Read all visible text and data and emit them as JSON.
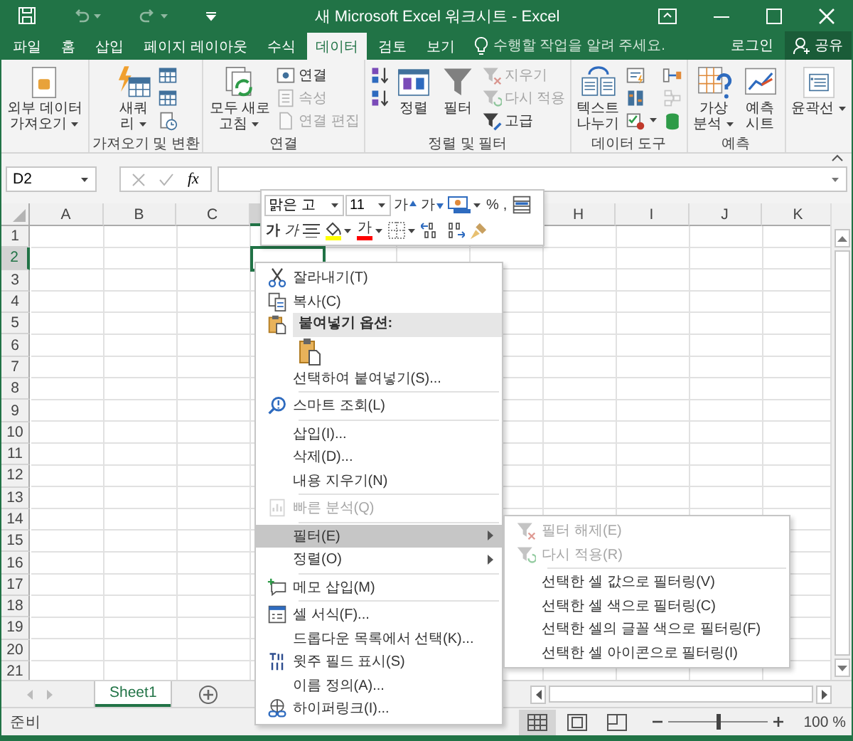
{
  "window": {
    "title": "새 Microsoft Excel 워크시트 - Excel"
  },
  "tabs": [
    {
      "label": "파일",
      "selected": false
    },
    {
      "label": "홈",
      "selected": false
    },
    {
      "label": "삽입",
      "selected": false
    },
    {
      "label": "페이지 레이아웃",
      "selected": false
    },
    {
      "label": "수식",
      "selected": false
    },
    {
      "label": "데이터",
      "selected": true
    },
    {
      "label": "검토",
      "selected": false
    },
    {
      "label": "보기",
      "selected": false
    }
  ],
  "tell_me": {
    "placeholder": "수행할 작업을 알려 주세요."
  },
  "account": {
    "login": "로그인",
    "share": "공유"
  },
  "ribbon": {
    "groups": [
      {
        "buttons": [
          {
            "kind": "large",
            "lines": [
              "외부 데이터",
              "가져오기"
            ],
            "dropdown": true
          }
        ]
      },
      {
        "label": "가져오기 및 변환",
        "buttons": [
          {
            "kind": "large",
            "lines": [
              "새쿼",
              "리"
            ],
            "dropdown": true
          },
          {
            "kind": "icon"
          },
          {
            "kind": "icon"
          },
          {
            "kind": "icon"
          }
        ]
      },
      {
        "label": "연결",
        "buttons": [
          {
            "kind": "large",
            "lines": [
              "모두 새로",
              "고침"
            ],
            "dropdown": true
          },
          {
            "kind": "small",
            "label": "연결",
            "disabled": false
          },
          {
            "kind": "small",
            "label": "속성",
            "disabled": true
          },
          {
            "kind": "small",
            "label": "연결 편집",
            "disabled": true
          }
        ]
      },
      {
        "label": "정렬 및 필터",
        "buttons": [
          {
            "kind": "icon"
          },
          {
            "kind": "icon"
          },
          {
            "kind": "large",
            "lines": [
              "정렬"
            ]
          },
          {
            "kind": "large",
            "lines": [
              "필터"
            ]
          },
          {
            "kind": "small",
            "label": "지우기",
            "disabled": true
          },
          {
            "kind": "small",
            "label": "다시 적용",
            "disabled": true
          },
          {
            "kind": "small",
            "label": "고급",
            "disabled": false
          }
        ]
      },
      {
        "label": "데이터 도구",
        "buttons": [
          {
            "kind": "large",
            "lines": [
              "텍스트",
              "나누기"
            ]
          },
          {
            "kind": "icon"
          },
          {
            "kind": "icon"
          },
          {
            "kind": "icon",
            "dropdown": true
          },
          {
            "kind": "icon"
          },
          {
            "kind": "icon",
            "disabled": true
          },
          {
            "kind": "icon"
          }
        ]
      },
      {
        "label": "예측",
        "buttons": [
          {
            "kind": "large",
            "lines": [
              "가상",
              "분석"
            ],
            "dropdown": true
          },
          {
            "kind": "large",
            "lines": [
              "예측",
              "시트"
            ]
          }
        ]
      },
      {
        "buttons": [
          {
            "kind": "large",
            "lines": [
              "윤곽선"
            ],
            "dropdown": true
          }
        ]
      }
    ]
  },
  "formula_bar": {
    "name_box": "D2",
    "function_label": "fx"
  },
  "grid": {
    "columns": [
      {
        "label": "A",
        "selected": false
      },
      {
        "label": "B",
        "selected": false
      },
      {
        "label": "C",
        "selected": false
      },
      {
        "selected": true
      },
      {},
      {},
      {},
      {
        "label": "H",
        "selected": false
      },
      {
        "label": "I",
        "selected": false
      },
      {
        "label": "J",
        "selected": false
      },
      {
        "label": "K",
        "selected": false
      }
    ],
    "rows": [
      {
        "label": "1",
        "selected": false
      },
      {
        "label": "2",
        "selected": true
      },
      {
        "label": "3",
        "selected": false
      },
      {
        "label": "4",
        "selected": false
      },
      {
        "label": "5",
        "selected": false
      },
      {
        "label": "6",
        "selected": false
      },
      {
        "label": "7",
        "selected": false
      },
      {
        "label": "8",
        "selected": false
      },
      {
        "label": "9",
        "selected": false
      },
      {
        "label": "10",
        "selected": false
      },
      {
        "label": "11",
        "selected": false
      },
      {
        "label": "12",
        "selected": false
      },
      {
        "label": "13",
        "selected": false
      },
      {
        "label": "14",
        "selected": false
      },
      {
        "label": "15",
        "selected": false
      },
      {
        "label": "16",
        "selected": false
      },
      {
        "label": "17",
        "selected": false
      },
      {
        "label": "18",
        "selected": false
      },
      {
        "label": "19",
        "selected": false
      },
      {
        "label": "20",
        "selected": false
      },
      {
        "label": "21",
        "selected": false
      }
    ]
  },
  "mini_toolbar": {
    "font": "맑은 고",
    "size": "11",
    "top": [
      {
        "kind": "grow",
        "text": "가"
      },
      {
        "kind": "shrink",
        "text": "가"
      },
      {
        "kind": "accounting"
      },
      {
        "kind": "text",
        "text": "%"
      },
      {
        "kind": "text",
        "text": ","
      },
      {
        "kind": "table"
      }
    ],
    "bottom": [
      {
        "kind": "bold",
        "text": "가"
      },
      {
        "kind": "italic",
        "text": "가"
      },
      {
        "kind": "align"
      },
      {
        "kind": "fill",
        "color": "#ffff00"
      },
      {
        "kind": "font-color",
        "text": "가",
        "color": "#ff0000"
      },
      {
        "kind": "borders"
      },
      {
        "kind": "inc-decimal"
      },
      {
        "kind": "dec-decimal"
      },
      {
        "kind": "painter"
      }
    ]
  },
  "context_menu": {
    "items": [
      {
        "kind": "item",
        "label": "잘라내기(T)",
        "disabled": false,
        "selected": false
      },
      {
        "kind": "item",
        "label": "복사(C)",
        "disabled": false,
        "selected": false
      },
      {
        "kind": "header",
        "label": "붙여넣기 옵션:"
      },
      {
        "kind": "paste"
      },
      {
        "kind": "item",
        "label": "선택하여 붙여넣기(S)...",
        "disabled": false,
        "selected": false
      },
      {
        "kind": "separator"
      },
      {
        "kind": "item",
        "label": "스마트 조회(L)",
        "disabled": false,
        "selected": false
      },
      {
        "kind": "separator"
      },
      {
        "kind": "item",
        "label": "삽입(I)...",
        "disabled": false,
        "selected": false
      },
      {
        "kind": "item",
        "label": "삭제(D)...",
        "disabled": false,
        "selected": false
      },
      {
        "kind": "item",
        "label": "내용 지우기(N)",
        "disabled": false,
        "selected": false
      },
      {
        "kind": "separator"
      },
      {
        "kind": "item",
        "label": "빠른 분석(Q)",
        "disabled": true,
        "selected": false
      },
      {
        "kind": "separator"
      },
      {
        "kind": "item",
        "label": "필터(E)",
        "disabled": false,
        "selected": true,
        "submenu": true
      },
      {
        "kind": "item",
        "label": "정렬(O)",
        "disabled": false,
        "selected": false,
        "submenu": true
      },
      {
        "kind": "separator"
      },
      {
        "kind": "item",
        "label": "메모 삽입(M)",
        "disabled": false,
        "selected": false
      },
      {
        "kind": "separator"
      },
      {
        "kind": "item",
        "label": "셀 서식(F)...",
        "disabled": false,
        "selected": false
      },
      {
        "kind": "item",
        "label": "드롭다운 목록에서 선택(K)...",
        "disabled": false,
        "selected": false
      },
      {
        "kind": "item",
        "label": "윗주 필드 표시(S)",
        "disabled": false,
        "selected": false
      },
      {
        "kind": "item",
        "label": "이름 정의(A)...",
        "disabled": false,
        "selected": false
      },
      {
        "kind": "item",
        "label": "하이퍼링크(I)...",
        "disabled": false,
        "selected": false
      }
    ]
  },
  "submenu": {
    "items": [
      {
        "kind": "item",
        "label": "필터 해제(E)",
        "disabled": true
      },
      {
        "kind": "item",
        "label": "다시 적용(R)",
        "disabled": true
      },
      {
        "kind": "separator"
      },
      {
        "kind": "item",
        "label": "선택한 셀 값으로 필터링(V)",
        "disabled": false
      },
      {
        "kind": "item",
        "label": "선택한 셀 색으로 필터링(C)",
        "disabled": false
      },
      {
        "kind": "item",
        "label": "선택한 셀의 글꼴 색으로 필터링(F)",
        "disabled": false
      },
      {
        "kind": "item",
        "label": "선택한 셀 아이콘으로 필터링(I)",
        "disabled": false
      }
    ]
  },
  "sheet_tabs": [
    {
      "label": "Sheet1",
      "selected": true
    }
  ],
  "status_bar": {
    "text": "준비",
    "views": [
      {
        "selected": true
      },
      {
        "selected": false
      },
      {
        "selected": false
      }
    ],
    "zoom": {
      "level": 0.5,
      "reading": "100 %"
    }
  }
}
